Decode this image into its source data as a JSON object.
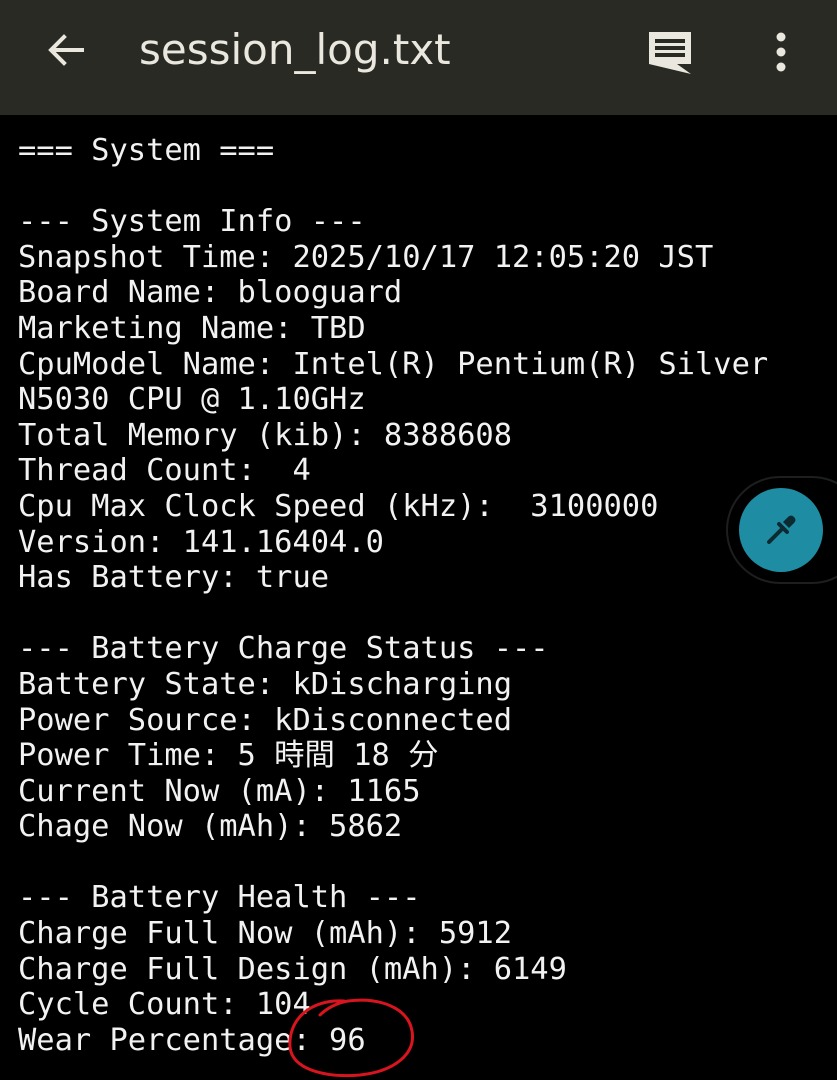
{
  "app_bar": {
    "title": "session_log.txt",
    "background": "#292a24",
    "icons": {
      "back": "arrow-back-icon",
      "notes": "comment-icon",
      "menu": "more-vert-icon"
    }
  },
  "log": {
    "lines": [
      "=== System ===",
      "",
      "--- System Info ---",
      "Snapshot Time: 2025/10/17 12:05:20 JST",
      "Board Name: blooguard",
      "Marketing Name: TBD",
      "CpuModel Name: Intel(R) Pentium(R) Silver",
      "N5030 CPU @ 1.10GHz",
      "Total Memory (kib): 8388608",
      "Thread Count:  4",
      "Cpu Max Clock Speed (kHz):  3100000",
      "Version: 141.16404.0",
      "Has Battery: true",
      "",
      "--- Battery Charge Status ---",
      "Battery State: kDischarging",
      "Power Source: kDisconnected",
      "Power Time: 5 時間 18 分",
      "Current Now (mA): 1165",
      "Chage Now (mAh): 5862",
      "",
      "--- Battery Health ---",
      "Charge Full Now (mAh): 5912",
      "Charge Full Design (mAh): 6149",
      "Cycle Count: 104",
      "Wear Percentage: 96"
    ]
  },
  "fab": {
    "icon": "eyedropper-icon",
    "color": "#1e8da3"
  },
  "annotation": {
    "color": "#d8141e"
  }
}
